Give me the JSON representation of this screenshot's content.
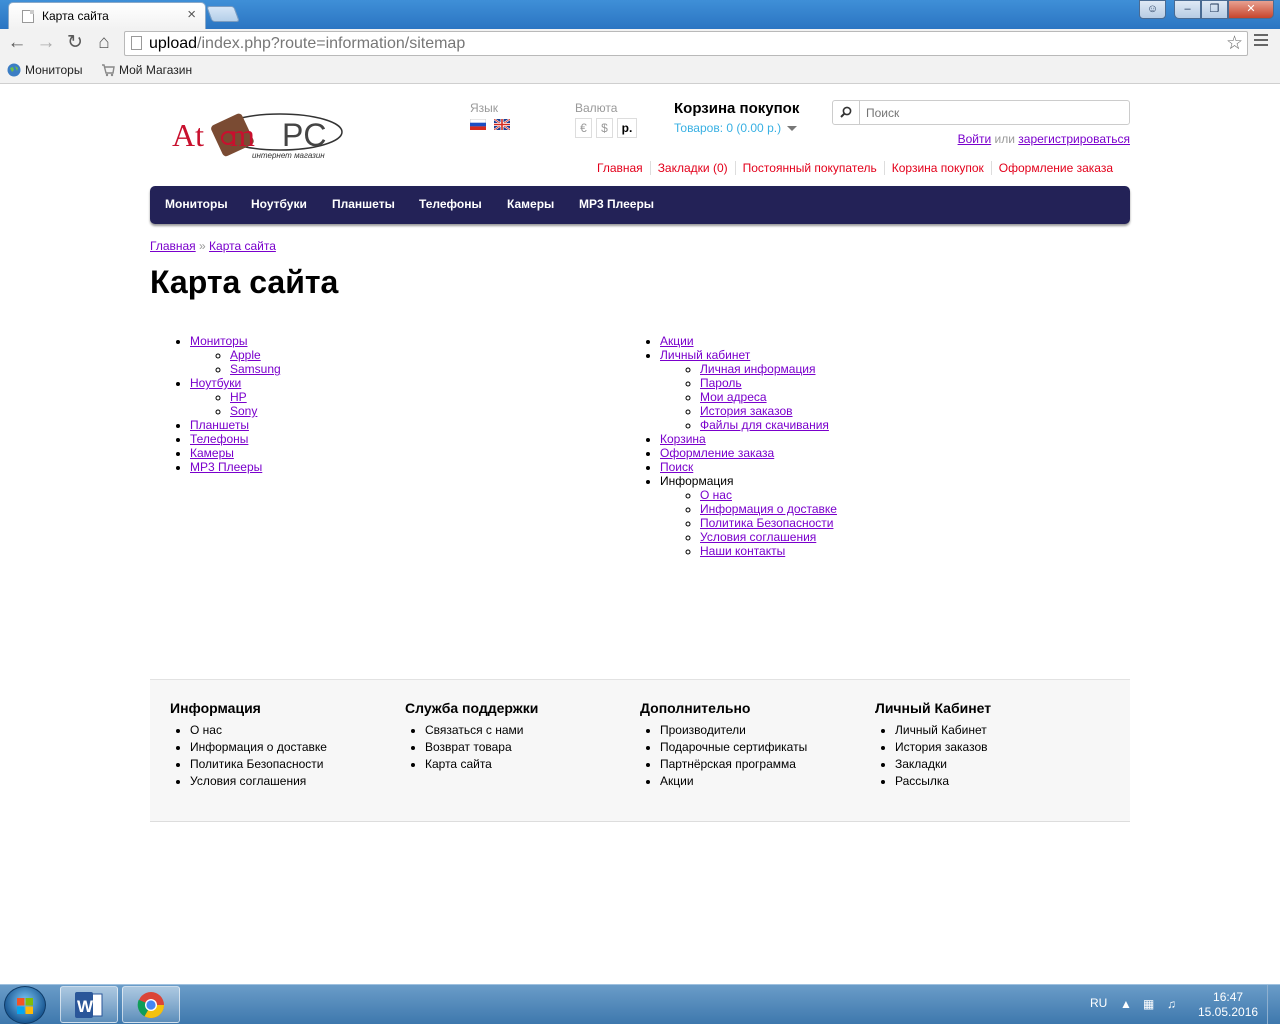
{
  "browser": {
    "tab_title": "Карта сайта",
    "tab_close": "×",
    "url_host": "upload",
    "url_path": "/index.php?route=information/sitemap",
    "bookmarks": [
      "Мониторы",
      "Мой Магазин"
    ]
  },
  "header": {
    "language_label": "Язык",
    "currency_label": "Валюта",
    "currencies": [
      "€",
      "$",
      "р."
    ],
    "cart_title": "Корзина покупок",
    "cart_summary": "Товаров: 0 (0.00 р.)",
    "search_placeholder": "Поиск",
    "login_link": "Войти",
    "login_or": " или ",
    "register_link": "зарегистрироваться",
    "top_links": [
      "Главная",
      "Закладки (0)",
      "Постоянный покупатель",
      "Корзина покупок",
      "Оформление заказа"
    ]
  },
  "menu": [
    "Мониторы",
    "Ноутбуки",
    "Планшеты",
    "Телефоны",
    "Камеры",
    "MP3 Плееры"
  ],
  "breadcrumb": {
    "home": "Главная",
    "sep": " » ",
    "current": "Карта сайта"
  },
  "page_title": "Карта сайта",
  "sitemap": {
    "left": [
      {
        "label": "Мониторы",
        "children": [
          "Apple",
          "Samsung"
        ]
      },
      {
        "label": "Ноутбуки",
        "children": [
          "HP",
          "Sony"
        ]
      },
      {
        "label": "Планшеты",
        "children": []
      },
      {
        "label": "Телефоны",
        "children": []
      },
      {
        "label": "Камеры",
        "children": []
      },
      {
        "label": "MP3 Плееры",
        "children": []
      }
    ],
    "right": [
      {
        "label": "Акции",
        "link": true,
        "children": []
      },
      {
        "label": "Личный кабинет",
        "link": true,
        "children": [
          "Личная информация",
          "Пароль",
          "Мои адреса",
          "История заказов",
          "Файлы для скачивания"
        ]
      },
      {
        "label": "Корзина",
        "link": true,
        "children": []
      },
      {
        "label": "Оформление заказа",
        "link": true,
        "children": []
      },
      {
        "label": "Поиск",
        "link": true,
        "children": []
      },
      {
        "label": "Информация",
        "link": false,
        "children": [
          "О нас",
          "Информация о доставке",
          "Политика Безопасности",
          "Условия соглашения",
          "Наши контакты"
        ]
      }
    ]
  },
  "footer": [
    {
      "title": "Информация",
      "items": [
        "О нас",
        "Информация о доставке",
        "Политика Безопасности",
        "Условия соглашения"
      ]
    },
    {
      "title": "Служба поддержки",
      "items": [
        "Связаться с нами",
        "Возврат товара",
        "Карта сайта"
      ]
    },
    {
      "title": "Дополнительно",
      "items": [
        "Производители",
        "Подарочные сертификаты",
        "Партнёрская программа",
        "Акции"
      ]
    },
    {
      "title": "Личный Кабинет",
      "items": [
        "Личный Кабинет",
        "История заказов",
        "Закладки",
        "Рассылка"
      ]
    }
  ],
  "taskbar": {
    "lang": "RU",
    "time": "16:47",
    "date": "15.05.2016"
  },
  "colors": {
    "menu_bg": "#232257",
    "link": "#7a00cc",
    "top_link": "#e3001b",
    "cart_sum": "#38b0e3"
  }
}
